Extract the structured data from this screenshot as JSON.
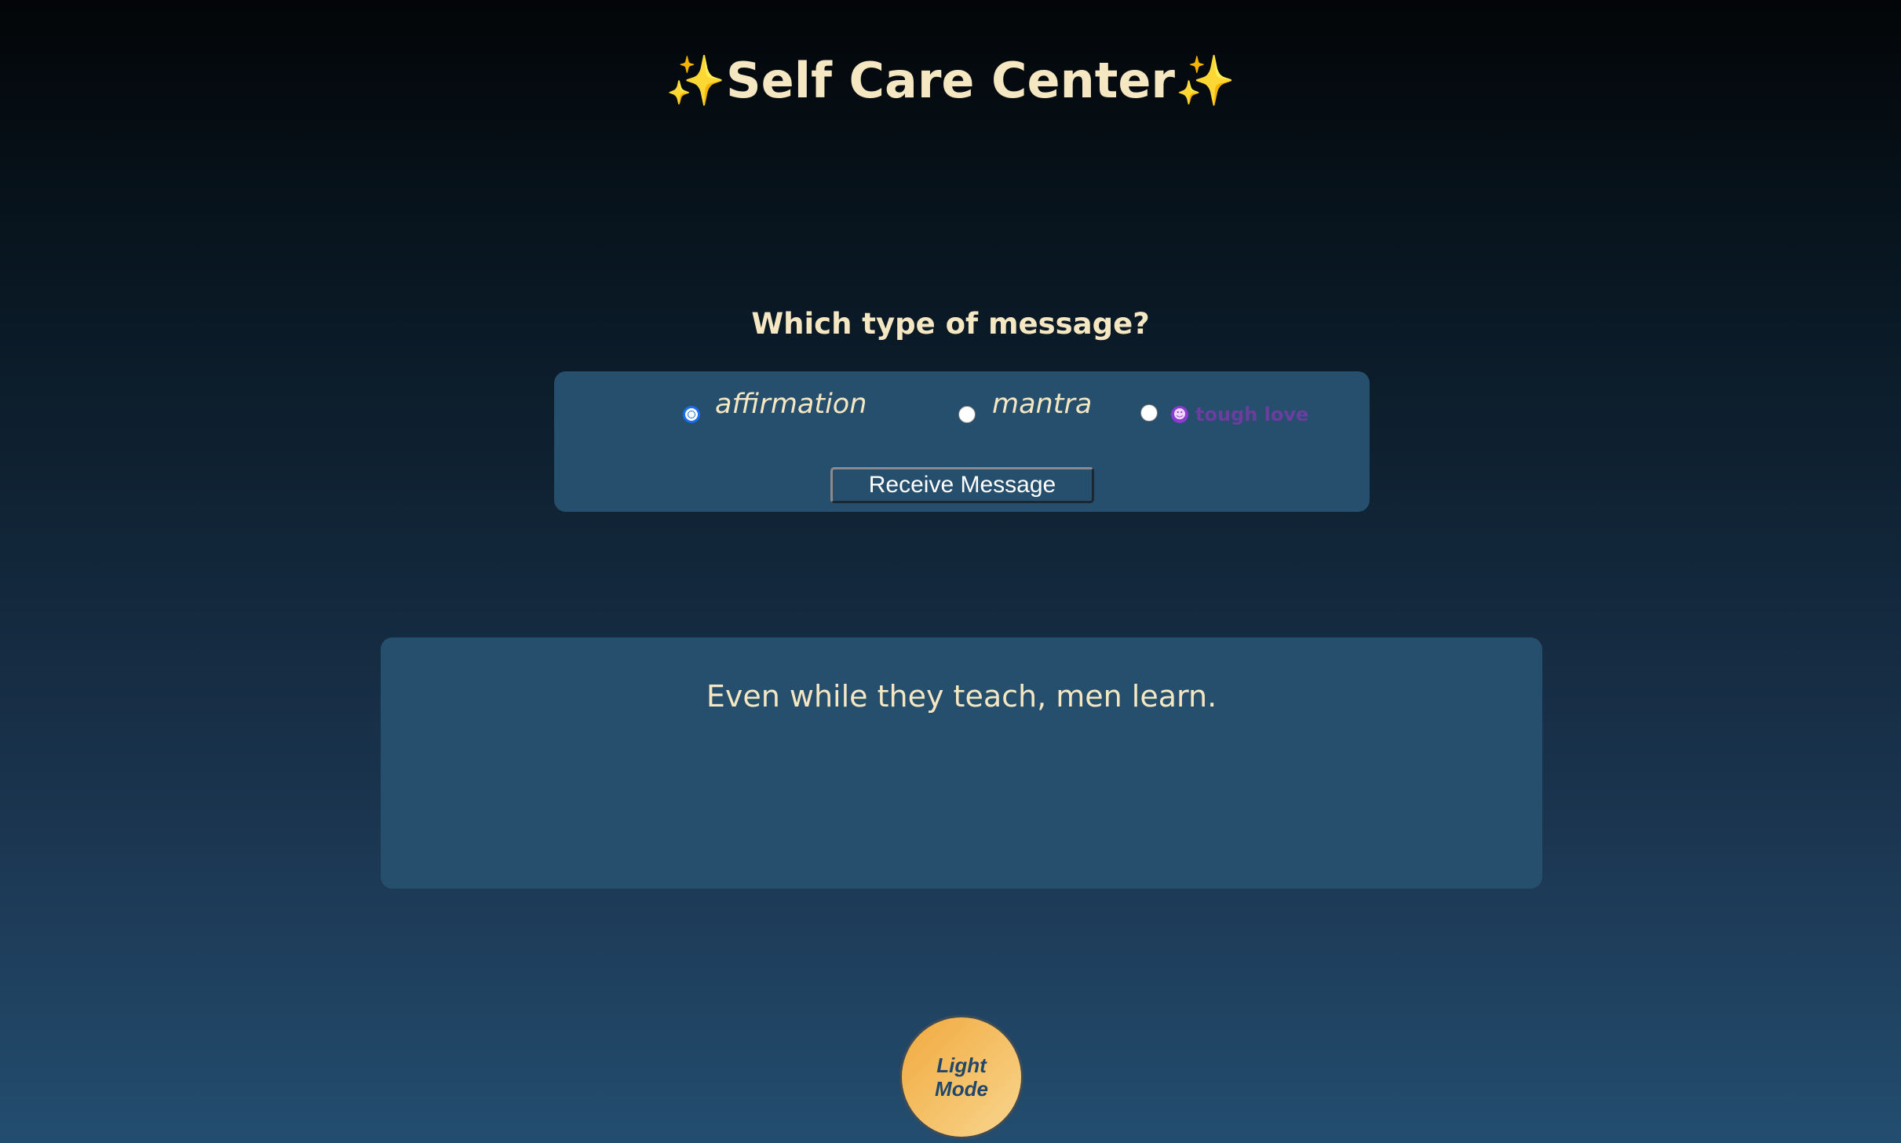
{
  "header": {
    "title": "Self Care Center",
    "sparkle": "✨"
  },
  "form": {
    "question": "Which type of message?",
    "options": [
      {
        "label": "affirmation",
        "checked": true
      },
      {
        "label": "mantra",
        "checked": false
      },
      {
        "label": "tough love",
        "checked": false,
        "icon": "devil-face-icon"
      }
    ],
    "submit_label": "Receive Message"
  },
  "message": {
    "text": "Even while they teach, men learn."
  },
  "theme_toggle": {
    "label": "Light Mode"
  },
  "colors": {
    "text_primary": "#f6e7c3",
    "panel_bg": "#264f6e",
    "toggle_accent": "#f5c26a",
    "tough_love": "#6a3e9e"
  }
}
